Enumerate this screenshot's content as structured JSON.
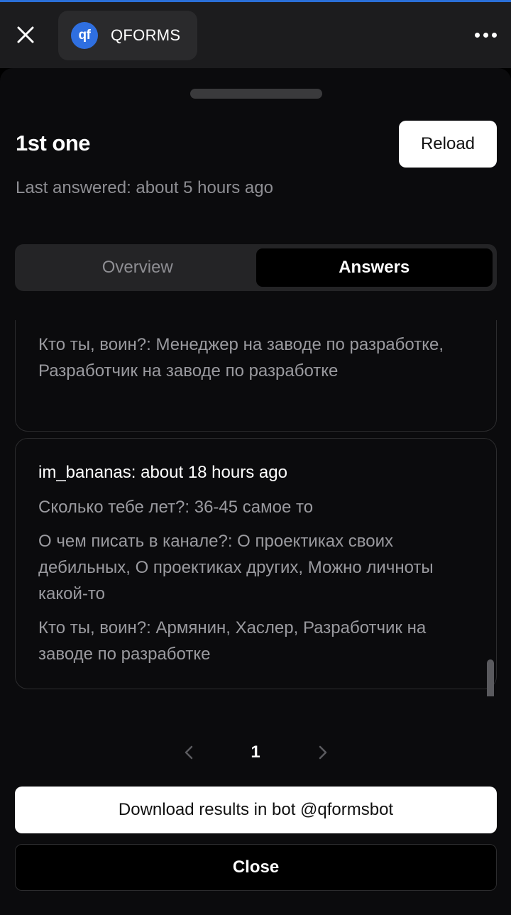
{
  "app": {
    "name": "QFORMS",
    "logo_text": "qf",
    "brand_color": "#2f6fe0"
  },
  "header": {
    "title": "1st one",
    "reload_label": "Reload",
    "subtitle": "Last answered: about 5 hours ago"
  },
  "tabs": [
    {
      "label": "Overview",
      "active": false
    },
    {
      "label": "Answers",
      "active": true
    }
  ],
  "responses": [
    {
      "author": "",
      "answers": [
        "Кто ты, воин?: Менеджер на заводе по разработке, Разработчик на заводе по разработке"
      ]
    },
    {
      "author": "im_bananas: about 18 hours ago",
      "answers": [
        "Сколько тебе лет?: 36-45 самое то",
        "О чем писать в канале?: О проектиках своих дебильных, О проектиках других, Можно личноты какой-то",
        "Кто ты, воин?: Армянин, Хаслер, Разработчик на заводе по разработке"
      ]
    }
  ],
  "pagination": {
    "current_page": "1",
    "prev_icon": "chevron-left-icon",
    "next_icon": "chevron-right-icon"
  },
  "actions": {
    "download_label": "Download results in bot @qformsbot",
    "close_label": "Close"
  },
  "icons": {
    "close": "close-icon",
    "more": "more-horizontal-icon"
  }
}
